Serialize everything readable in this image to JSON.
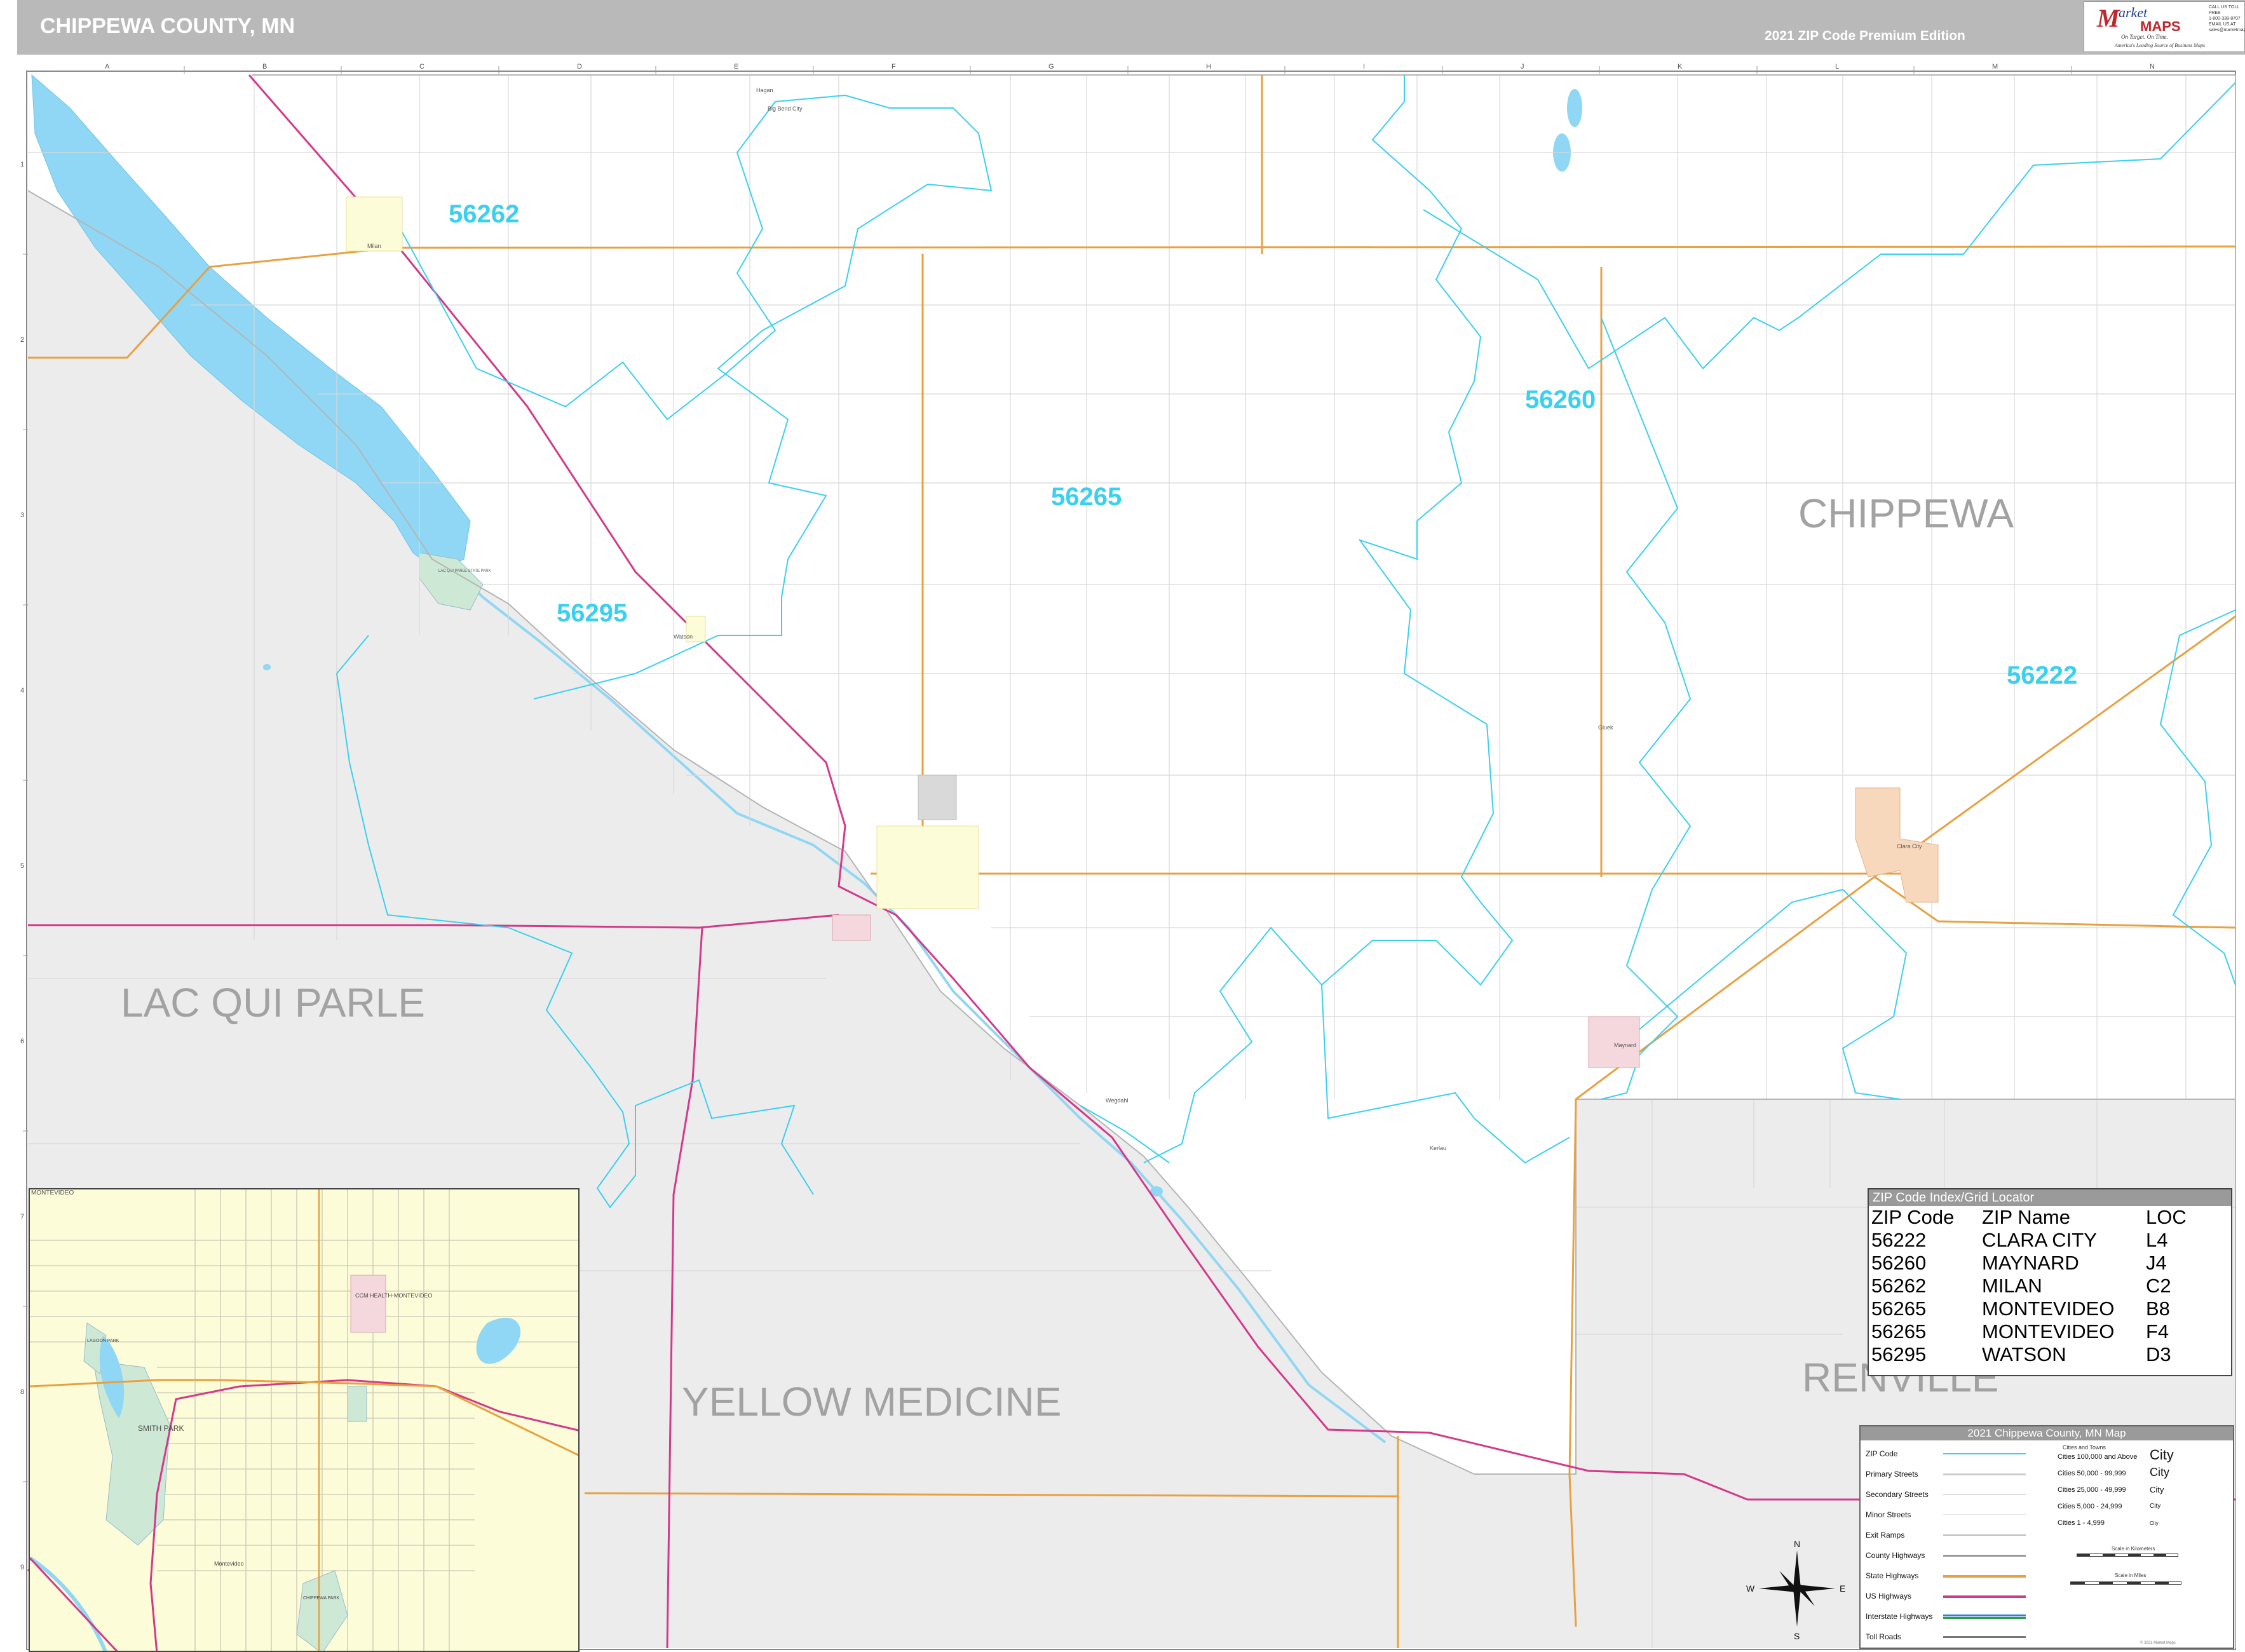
{
  "header": {
    "title": "CHIPPEWA COUNTY, MN",
    "edition": "2021 ZIP Code Premium Edition"
  },
  "logo": {
    "mark": "M",
    "market": "arket",
    "maps": "MAPS",
    "tagline": "On Target.  On Time.",
    "subtitle": "America's Leading Source of Business Maps",
    "contact_lines": [
      "CALL US TOLL FREE",
      "1-800-338-8707",
      "EMAIL US AT",
      "sales@marketmaps.com"
    ]
  },
  "grid": {
    "columns": [
      "A",
      "B",
      "C",
      "D",
      "E",
      "F",
      "G",
      "H",
      "I",
      "J",
      "K",
      "L",
      "M",
      "N"
    ],
    "rows": [
      "1",
      "2",
      "3",
      "4",
      "5",
      "6",
      "7",
      "8",
      "9"
    ]
  },
  "counties": {
    "chippewa": "CHIPPEWA",
    "lac_qui_parle": "LAC QUI PARLE",
    "yellow_medicine": "YELLOW MEDICINE",
    "renville": "RENVILLE"
  },
  "zip_labels": {
    "z56262": "56262",
    "z56260": "56260",
    "z56265": "56265",
    "z56295": "56295",
    "z56222": "56222"
  },
  "places": {
    "milan": "Milan",
    "watson": "Watson",
    "montevideo": "Montevideo",
    "clara_city": "Clara City",
    "maynard": "Maynard",
    "gluek": "Gluek",
    "wegdahl": "Wegdahl",
    "kerlau": "Kerlau",
    "big_bend": "Big Bend City",
    "hagan": "Hagan",
    "lqp_park": "LAC QUI PARLE STATE PARK"
  },
  "zip_index": {
    "title": "ZIP Code Index/Grid Locator",
    "headers": [
      "ZIP Code",
      "ZIP Name",
      "LOC"
    ],
    "rows": [
      [
        "56222",
        "CLARA CITY",
        "L4"
      ],
      [
        "56260",
        "MAYNARD",
        "J4"
      ],
      [
        "56262",
        "MILAN",
        "C2"
      ],
      [
        "56265",
        "MONTEVIDEO",
        "B8"
      ],
      [
        "56265",
        "MONTEVIDEO",
        "F4"
      ],
      [
        "56295",
        "WATSON",
        "D3"
      ]
    ]
  },
  "legend": {
    "title": "2021 Chippewa County, MN Map",
    "items": [
      {
        "label": "ZIP Code",
        "color": "#3ad0ee"
      },
      {
        "label": "Primary Streets",
        "color": "#cccccc"
      },
      {
        "label": "Secondary Streets",
        "color": "#dddddd"
      },
      {
        "label": "Minor Streets",
        "color": "#e6e6e6"
      },
      {
        "label": "Exit Ramps",
        "color": "#bbbbbb"
      },
      {
        "label": "County Highways",
        "color": "#999999"
      },
      {
        "label": "State Highways",
        "color": "#e8a040"
      },
      {
        "label": "US Highways",
        "color": "#d4388a"
      },
      {
        "label": "Interstate Highways",
        "color": "#2b7fd9"
      },
      {
        "label": "Toll Roads",
        "color": "#777777"
      }
    ],
    "cities_title": "Cities and Towns",
    "cities": [
      {
        "label": "Cities 100,000 and Above",
        "sample": "City"
      },
      {
        "label": "Cities 50,000 - 99,999",
        "sample": "City"
      },
      {
        "label": "Cities 25,000 - 49,999",
        "sample": "City"
      },
      {
        "label": "Cities 5,000 - 24,999",
        "sample": "City"
      },
      {
        "label": "Cities 1 - 4,999",
        "sample": "City"
      }
    ],
    "scale_km": "Scale in Kilometers",
    "scale_mi": "Scale in Miles",
    "copyright": "© 2021 Market Maps"
  },
  "compass": {
    "n": "N",
    "s": "S",
    "e": "E",
    "w": "W"
  },
  "inset": {
    "label": "MONTEVIDEO",
    "smith_park": "SMITH PARK",
    "ccm_health": "CCM HEALTH-MONTEVIDEO",
    "montevideo": "Montevideo",
    "lagoon_park": "LAGOON PARK",
    "chippewa_park": "CHIPPEWA PARK"
  },
  "colors": {
    "zip_boundary": "#3ad0ee",
    "county_gray": "#ececec",
    "water": "#8fd7f4",
    "state_highway": "#e8a040",
    "us_highway": "#d4388a",
    "city_fill": "#fdfcd8",
    "header_bg": "#b9b9b9"
  }
}
